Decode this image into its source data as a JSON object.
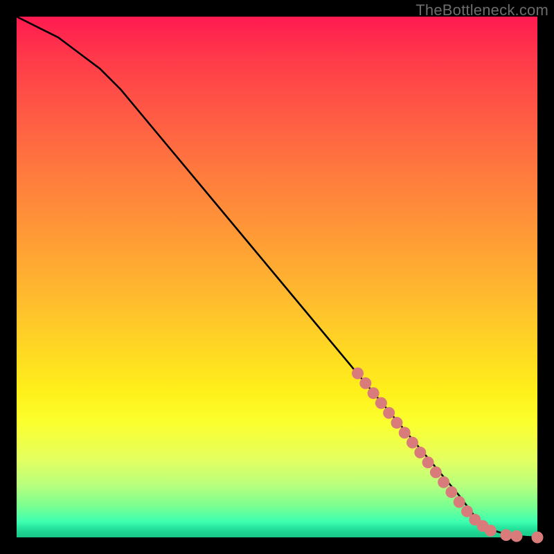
{
  "watermark": "TheBottleneck.com",
  "colors": {
    "curve": "#000000",
    "marker_fill": "#d97b7b",
    "marker_stroke": "#b85f5f",
    "bg_black": "#000000"
  },
  "chart_data": {
    "type": "line",
    "title": "",
    "xlabel": "",
    "ylabel": "",
    "xlim": [
      0,
      100
    ],
    "ylim": [
      0,
      100
    ],
    "grid": false,
    "legend": false,
    "series": [
      {
        "name": "bottleneck-curve",
        "x": [
          0,
          4,
          8,
          12,
          16,
          20,
          25,
          30,
          35,
          40,
          45,
          50,
          55,
          60,
          65,
          70,
          75,
          80,
          85,
          88,
          90,
          92,
          94,
          96,
          98,
          100
        ],
        "y": [
          100,
          98,
          96,
          93,
          90,
          86,
          80,
          74,
          68,
          62,
          56,
          50,
          44,
          38,
          32,
          26,
          20,
          14,
          8,
          4,
          2.2,
          1.2,
          0.6,
          0.3,
          0.1,
          0
        ]
      }
    ],
    "markers": {
      "name": "highlighted-segment",
      "x": [
        65.5,
        67,
        68.5,
        70,
        71.5,
        73,
        74.5,
        76,
        77.5,
        79,
        80.5,
        82,
        83.5,
        85,
        86.5,
        88,
        89.5,
        91,
        94,
        96,
        100
      ],
      "y": [
        31.5,
        29.6,
        27.7,
        25.8,
        23.9,
        22.0,
        20.1,
        18.2,
        16.3,
        14.4,
        12.5,
        10.6,
        8.7,
        6.8,
        5.0,
        3.4,
        2.2,
        1.3,
        0.45,
        0.25,
        0
      ]
    }
  }
}
